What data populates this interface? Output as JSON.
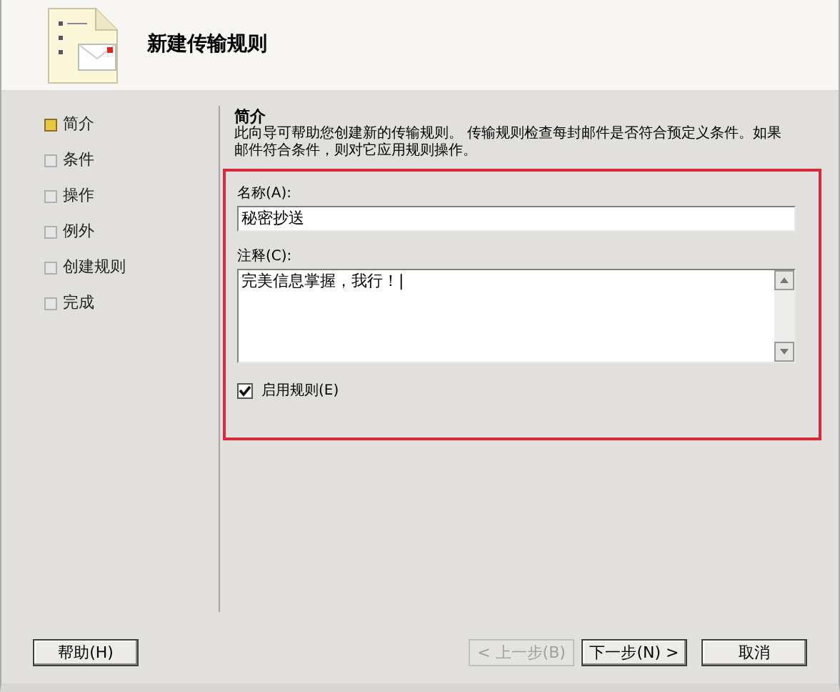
{
  "header": {
    "title": "新建传输规则"
  },
  "steps": [
    {
      "label": "简介",
      "selected": true
    },
    {
      "label": "条件",
      "selected": false
    },
    {
      "label": "操作",
      "selected": false
    },
    {
      "label": "例外",
      "selected": false
    },
    {
      "label": "创建规则",
      "selected": false
    },
    {
      "label": "完成",
      "selected": false
    }
  ],
  "intro": {
    "heading": "简介",
    "text": "此向导可帮助您创建新的传输规则。 传输规则检查每封邮件是否符合预定义条件。如果邮件符合条件，则对它应用规则操作。"
  },
  "name_field": {
    "label": "名称(A):",
    "value": "秘密抄送"
  },
  "comment_field": {
    "label": "注释(C):",
    "value": "完美信息掌握，我行！|"
  },
  "enable_rule": {
    "label": "启用规则(E)",
    "checked": true
  },
  "buttons": [
    {
      "label": "帮助(H)",
      "kind": "help",
      "disabled": false
    },
    {
      "label": "< 上一步(B)",
      "kind": "nav",
      "disabled": true
    },
    {
      "label": "下一步(N) >",
      "kind": "nav",
      "disabled": false
    },
    {
      "label": "取消",
      "kind": "nav",
      "disabled": false
    }
  ]
}
